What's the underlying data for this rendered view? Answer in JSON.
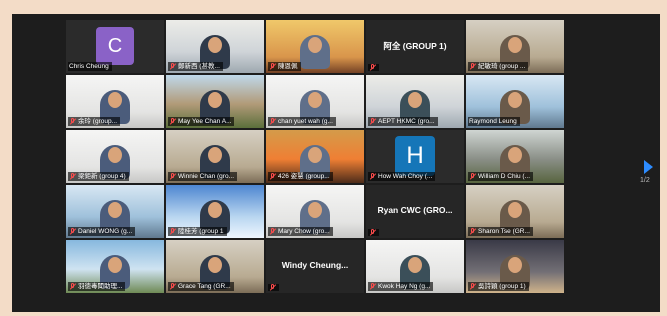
{
  "participants": [
    {
      "name": "Chris Cheung",
      "type": "avatar",
      "initial": "C",
      "color": "#8a62c7",
      "muted": false
    },
    {
      "name": "鄭新西 (甚教...",
      "type": "video",
      "scene": "office",
      "muted": true
    },
    {
      "name": "陳恩佩",
      "type": "video",
      "scene": "warm",
      "muted": true
    },
    {
      "name": "阿全 (GROUP 1)",
      "type": "name",
      "muted": true
    },
    {
      "name": "紀敏琦 (group ...",
      "type": "video",
      "scene": "room",
      "muted": true
    },
    {
      "name": "余玲 (group...",
      "type": "video",
      "scene": "white",
      "muted": true
    },
    {
      "name": "May Yee Chan A...",
      "type": "video",
      "scene": "hill",
      "muted": true
    },
    {
      "name": "chan yuet wah (g...",
      "type": "video",
      "scene": "white",
      "muted": true
    },
    {
      "name": "AEPT HKMC (gro...",
      "type": "video",
      "scene": "office",
      "muted": true
    },
    {
      "name": "Raymond Leung",
      "type": "video",
      "scene": "blue",
      "muted": false,
      "speaking": true
    },
    {
      "name": "梁鉅新 (group 4)",
      "type": "video",
      "scene": "white",
      "muted": true
    },
    {
      "name": "Winnie Chan (gro...",
      "type": "video",
      "scene": "room",
      "muted": true
    },
    {
      "name": "426 姿慧 (group...",
      "type": "video",
      "scene": "sunset",
      "muted": true
    },
    {
      "name": "How Wah Choy (...",
      "type": "avatar",
      "initial": "H",
      "color": "#1576b8",
      "muted": true
    },
    {
      "name": "William D Chiu (...",
      "type": "video",
      "scene": "stone",
      "muted": true
    },
    {
      "name": "Daniel WONG (g...",
      "type": "video",
      "scene": "blue",
      "muted": true
    },
    {
      "name": "陸桂芳 (group 1",
      "type": "video",
      "scene": "cloud",
      "muted": true
    },
    {
      "name": "Mary Chow (gro...",
      "type": "video",
      "scene": "white",
      "muted": true
    },
    {
      "name": "Ryan CWC (GRO...",
      "type": "name",
      "muted": true
    },
    {
      "name": "Sharon Tse (GR...",
      "type": "video",
      "scene": "room",
      "muted": true
    },
    {
      "name": "羽徳毒聞助理...",
      "type": "video",
      "scene": "sky",
      "muted": true
    },
    {
      "name": "Grace Tang (GR...",
      "type": "video",
      "scene": "room",
      "muted": true
    },
    {
      "name": "Windy Cheung...",
      "type": "name",
      "muted": true
    },
    {
      "name": "Kwok Hay Ng (g...",
      "type": "video",
      "scene": "white",
      "muted": true
    },
    {
      "name": "吳詩穎 (group 1)",
      "type": "video",
      "scene": "night",
      "muted": true
    }
  ],
  "pager": "1/2",
  "icons": {
    "next": "next-page-arrow-icon",
    "mute": "microphone-muted-icon"
  }
}
